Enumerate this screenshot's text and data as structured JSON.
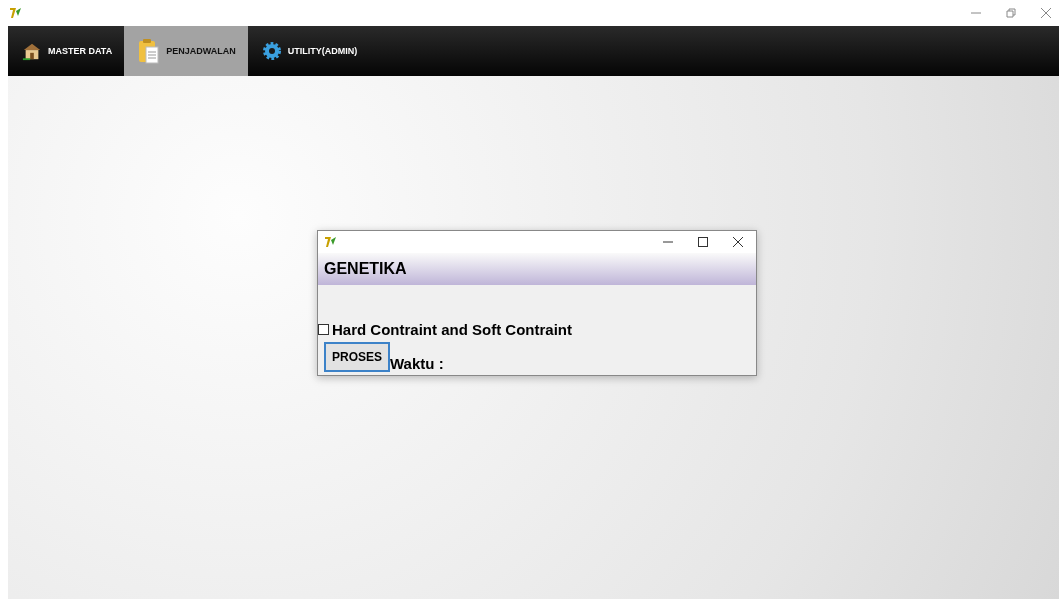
{
  "tabs": [
    {
      "label": "MASTER DATA",
      "kind": "house",
      "selected": false
    },
    {
      "label": "PENJADWALAN",
      "kind": "clipboard",
      "selected": true
    },
    {
      "label": "UTILITY(ADMIN)",
      "kind": "gear",
      "selected": false
    }
  ],
  "dialog": {
    "header": "GENETIKA",
    "checkbox": {
      "label": "Hard Contraint and Soft Contraint",
      "checked": false
    },
    "button": "PROSES",
    "time_label": "Waktu :"
  }
}
